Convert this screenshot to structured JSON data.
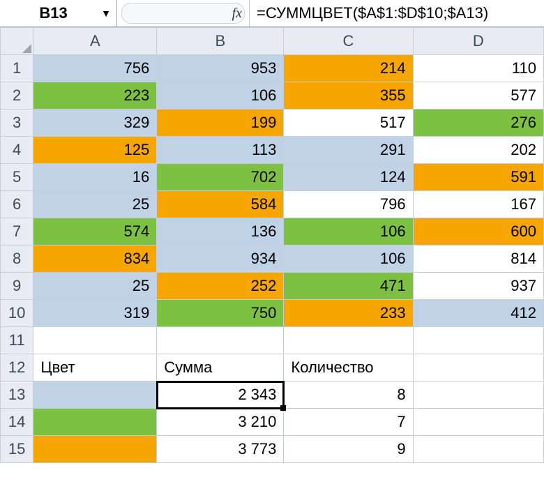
{
  "name_box": "B13",
  "fx_label": "fx",
  "formula": "=СУММЦВЕТ($A$1:$D$10;$A13)",
  "columns": [
    "A",
    "B",
    "C",
    "D"
  ],
  "row_numbers": [
    "1",
    "2",
    "3",
    "4",
    "5",
    "6",
    "7",
    "8",
    "9",
    "10",
    "11",
    "12",
    "13",
    "14",
    "15"
  ],
  "cells": {
    "r1": {
      "A": "756",
      "B": "953",
      "C": "214",
      "D": "110"
    },
    "r2": {
      "A": "223",
      "B": "106",
      "C": "355",
      "D": "577"
    },
    "r3": {
      "A": "329",
      "B": "199",
      "C": "517",
      "D": "276"
    },
    "r4": {
      "A": "125",
      "B": "113",
      "C": "291",
      "D": "202"
    },
    "r5": {
      "A": "16",
      "B": "702",
      "C": "124",
      "D": "591"
    },
    "r6": {
      "A": "25",
      "B": "584",
      "C": "796",
      "D": "167"
    },
    "r7": {
      "A": "574",
      "B": "136",
      "C": "106",
      "D": "600"
    },
    "r8": {
      "A": "834",
      "B": "934",
      "C": "106",
      "D": "814"
    },
    "r9": {
      "A": "25",
      "B": "252",
      "C": "471",
      "D": "937"
    },
    "r10": {
      "A": "319",
      "B": "750",
      "C": "233",
      "D": "412"
    },
    "r12": {
      "A": "Цвет",
      "B": "Сумма",
      "C": "Количество"
    },
    "r13": {
      "B": "2 343",
      "C": "8"
    },
    "r14": {
      "B": "3 210",
      "C": "7"
    },
    "r15": {
      "B": "3 773",
      "C": "9"
    }
  },
  "chart_data": {
    "type": "table",
    "title": "Sum and count by cell color over A1:D10",
    "color_key_cells": [
      "A13",
      "A14",
      "A15"
    ],
    "cell_colors": {
      "blue": [
        "A1",
        "B1",
        "B2",
        "A3",
        "B4",
        "C4",
        "A5",
        "C5",
        "A6",
        "B7",
        "B8",
        "C8",
        "A9",
        "A10",
        "D10",
        "A13"
      ],
      "green": [
        "A2",
        "D3",
        "B5",
        "A7",
        "C7",
        "C9",
        "B10",
        "A14"
      ],
      "orange": [
        "C1",
        "C2",
        "B3",
        "A4",
        "D5",
        "B6",
        "D7",
        "A8",
        "B9",
        "C10",
        "A15"
      ],
      "none": [
        "D1",
        "D2",
        "C3",
        "D4",
        "C6",
        "D6",
        "D8",
        "D9"
      ]
    },
    "raw_values": [
      [
        756,
        953,
        214,
        110
      ],
      [
        223,
        106,
        355,
        577
      ],
      [
        329,
        199,
        517,
        276
      ],
      [
        125,
        113,
        291,
        202
      ],
      [
        16,
        702,
        124,
        591
      ],
      [
        25,
        584,
        796,
        167
      ],
      [
        574,
        136,
        106,
        600
      ],
      [
        834,
        934,
        106,
        814
      ],
      [
        25,
        252,
        471,
        937
      ],
      [
        319,
        750,
        233,
        412
      ]
    ],
    "summary_rows": [
      {
        "row": 13,
        "color": "blue",
        "sum": 2343,
        "count": 8
      },
      {
        "row": 14,
        "color": "green",
        "sum": 3210,
        "count": 7
      },
      {
        "row": 15,
        "color": "orange",
        "sum": 3773,
        "count": 9
      }
    ],
    "summary_headers": {
      "A": "Цвет",
      "B": "Сумма",
      "C": "Количество"
    }
  }
}
